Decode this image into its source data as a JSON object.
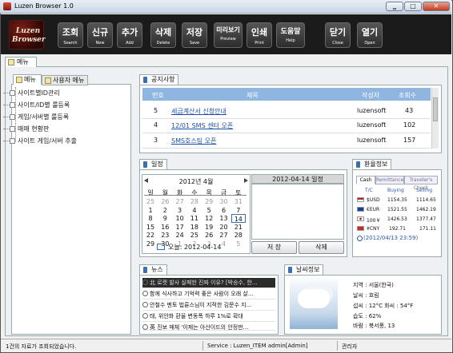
{
  "window": {
    "title": "Luzen Browser 1.0",
    "minimize": "‗",
    "maximize": "□",
    "close": "✕"
  },
  "logo": {
    "line1": "Luzen",
    "line2": "Browser"
  },
  "toolbar": [
    {
      "ko": "조회",
      "en": "Search"
    },
    {
      "ko": "신규",
      "en": "New"
    },
    {
      "ko": "추가",
      "en": "Add"
    },
    {
      "ko": "삭제",
      "en": "Delete"
    },
    {
      "ko": "저장",
      "en": "Save"
    },
    {
      "ko": "미리보기",
      "en": "Preview"
    },
    {
      "ko": "인쇄",
      "en": "Print"
    },
    {
      "ko": "도움말",
      "en": "Help"
    },
    {
      "ko": "닫기",
      "en": "Close"
    },
    {
      "ko": "열기",
      "en": "Open"
    }
  ],
  "main_tab": "메뉴",
  "left_tabs": [
    "메뉴",
    "사용자 메뉴"
  ],
  "tree": [
    "사이트별ID관리",
    "사이트/ID별 룰등록",
    "게임/서버별 룰등록",
    "매매 현황판",
    "사이트 게임/서버 추출"
  ],
  "notice": {
    "tab": "공지사항",
    "columns": [
      "번호",
      "제목",
      "작성자",
      "조회수"
    ],
    "rows": [
      [
        "5",
        "세금계산서 신청안내",
        "luzensoft",
        "43"
      ],
      [
        "4",
        "12/01 SMS 센터 오픈",
        "luzensoft",
        "102"
      ],
      [
        "3",
        "SMS호스팅 오픈",
        "luzensoft",
        "157"
      ]
    ]
  },
  "calendar": {
    "tab": "일정",
    "title": "2012년 4월",
    "weekdays": [
      "일",
      "월",
      "화",
      "수",
      "목",
      "금",
      "토"
    ],
    "rows": [
      [
        "25",
        "26",
        "27",
        "28",
        "29",
        "30",
        "31"
      ],
      [
        "1",
        "2",
        "3",
        "4",
        "5",
        "6",
        "7"
      ],
      [
        "8",
        "9",
        "10",
        "11",
        "12",
        "13",
        "14"
      ],
      [
        "15",
        "16",
        "17",
        "18",
        "19",
        "20",
        "21"
      ],
      [
        "22",
        "23",
        "24",
        "25",
        "26",
        "27",
        "28"
      ],
      [
        "29",
        "30",
        "1",
        "2",
        "3",
        "4",
        "5"
      ]
    ],
    "today_label": "오늘: 2012-04-14",
    "schedule_title": "2012-04-14 일정",
    "save": "저 장",
    "delete": "삭제"
  },
  "fx": {
    "tab": "환율정보",
    "tabs": [
      "Cash",
      "Remittance",
      "Traveler's Check"
    ],
    "columns": [
      "T/C",
      "Buying",
      "Selling"
    ],
    "rows": [
      {
        "cur": "$USD",
        "buy": "1154.35",
        "sell": "1114.65"
      },
      {
        "cur": "€EUR",
        "buy": "1521.55",
        "sell": "1462.19"
      },
      {
        "cur": "100￥",
        "buy": "1426.53",
        "sell": "1377.47"
      },
      {
        "cur": "¥CNY",
        "buy": "192.71",
        "sell": "171.11"
      }
    ],
    "date": "(2012/04/13 23:59)"
  },
  "news": {
    "tab": "뉴스",
    "items": [
      "北 로켓 발사 실패한 진짜 이유? [박승수, 한...",
      "함께 식사하고 기억력 좋은 사람이 오래 살...",
      "안철수 멘토 법륜스님이 지적한 김문수 지...",
      "태, 위안화 환율 변동폭 하루 1%로 확대",
      "英 진보 매체 '이제는 아산이드의 안정판..."
    ]
  },
  "weather": {
    "tab": "날씨정보",
    "region": "지역 : 서울(한국)",
    "sky": "날씨 : 흐림",
    "temp": "섭씨 : 12°C  화씨 : 54°F",
    "humidity": "습도 : 62%",
    "wind": "바람 : 북서풍, 13"
  },
  "status": {
    "message": "1건의 자료가 조회되었습니다.",
    "service": "Service : Luzen_ITEM  admin[Admin]",
    "role": "관리자"
  }
}
